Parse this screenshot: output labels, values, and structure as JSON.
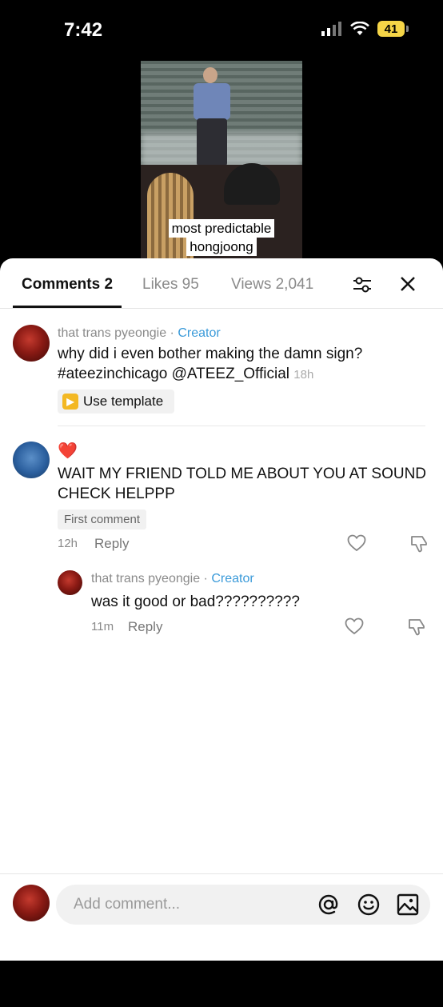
{
  "status_bar": {
    "time": "7:42",
    "battery": "41"
  },
  "video": {
    "caption_line1": "most predictable",
    "caption_line2": "hongjoong"
  },
  "tabs": [
    {
      "label": "Comments 2",
      "active": true
    },
    {
      "label": "Likes 95",
      "active": false
    },
    {
      "label": "Views 2,041",
      "active": false
    }
  ],
  "comments": [
    {
      "username": "that trans pyeongie",
      "separator": "·",
      "badge": "Creator",
      "text_line1": "why did i even bother making the damn sign?",
      "text_line2": "#ateezinchicago @ATEEZ_Official",
      "time": "18h",
      "template_label": "Use template"
    },
    {
      "emoji": "❤️",
      "text": "WAIT MY FRIEND TOLD ME ABOUT YOU AT SOUND CHECK HELPPP",
      "badge": "First comment",
      "time": "12h",
      "reply_label": "Reply",
      "reply": {
        "username": "that trans pyeongie",
        "separator": "·",
        "badge": "Creator",
        "text": "was it good or bad??????????",
        "time": "11m",
        "reply_label": "Reply"
      }
    }
  ],
  "composer": {
    "placeholder": "Add comment..."
  }
}
